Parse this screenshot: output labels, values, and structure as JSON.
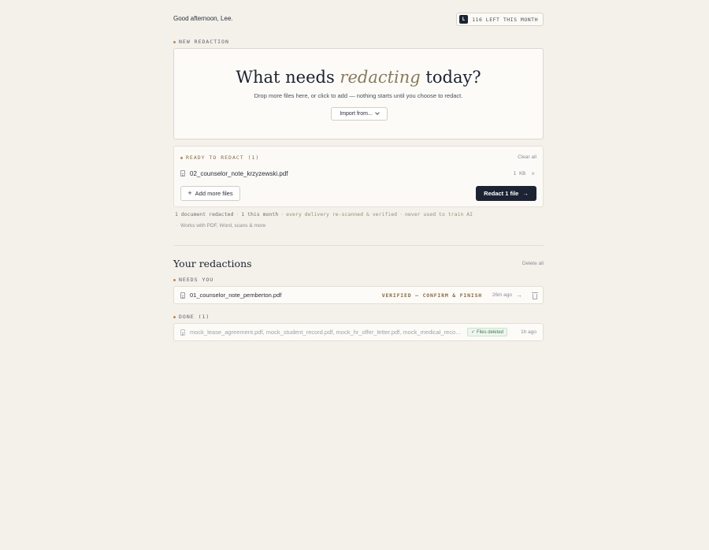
{
  "header": {
    "greeting": "Good afternoon, Lee.",
    "avatar_initial": "L",
    "quota": "116 LEFT THIS MONTH"
  },
  "new_redaction": {
    "section_label": "NEW REDACTION",
    "headline_pre": "What needs ",
    "headline_em": "redacting",
    "headline_post": " today?",
    "subline": "Drop more files here, or click to add — nothing starts until you choose to redact.",
    "import_label": "Import from..."
  },
  "ready": {
    "label": "READY TO REDACT (1)",
    "clear_all": "Clear all",
    "files": [
      {
        "name": "02_counselor_note_krzyzewski.pdf",
        "size": "1 KB"
      }
    ],
    "remove_glyph": "×",
    "add_more": "Add more files",
    "redact_button": "Redact 1 file",
    "arrow": "→"
  },
  "stats": {
    "parts": [
      "1 document redacted",
      "1 this month",
      "every delivery re-scanned & verified",
      "never used to train AI"
    ],
    "separator": "·",
    "works_with": "Works with PDF, Word, scans & more"
  },
  "your_redactions": {
    "title": "Your redactions",
    "delete_all": "Delete all",
    "needs_you_label": "NEEDS YOU",
    "needs_you": [
      {
        "name": "01_counselor_note_pemberton.pdf",
        "status": "VERIFIED — CONFIRM & FINISH",
        "ago": "26m ago"
      }
    ],
    "done_label": "DONE (1)",
    "done": [
      {
        "name": "mock_lease_agreement.pdf, mock_student_record.pdf, mock_hr_offer_letter.pdf, mock_medical_record.pdf",
        "badge": "Files deleted",
        "ago": "1h ago"
      }
    ]
  },
  "colors": {
    "background": "#f4f1eb",
    "primary_button": "#1c2333",
    "accent_dot": "#b8895a",
    "accent_italic": "#8a7a5c",
    "success": "#3d7a4b"
  }
}
